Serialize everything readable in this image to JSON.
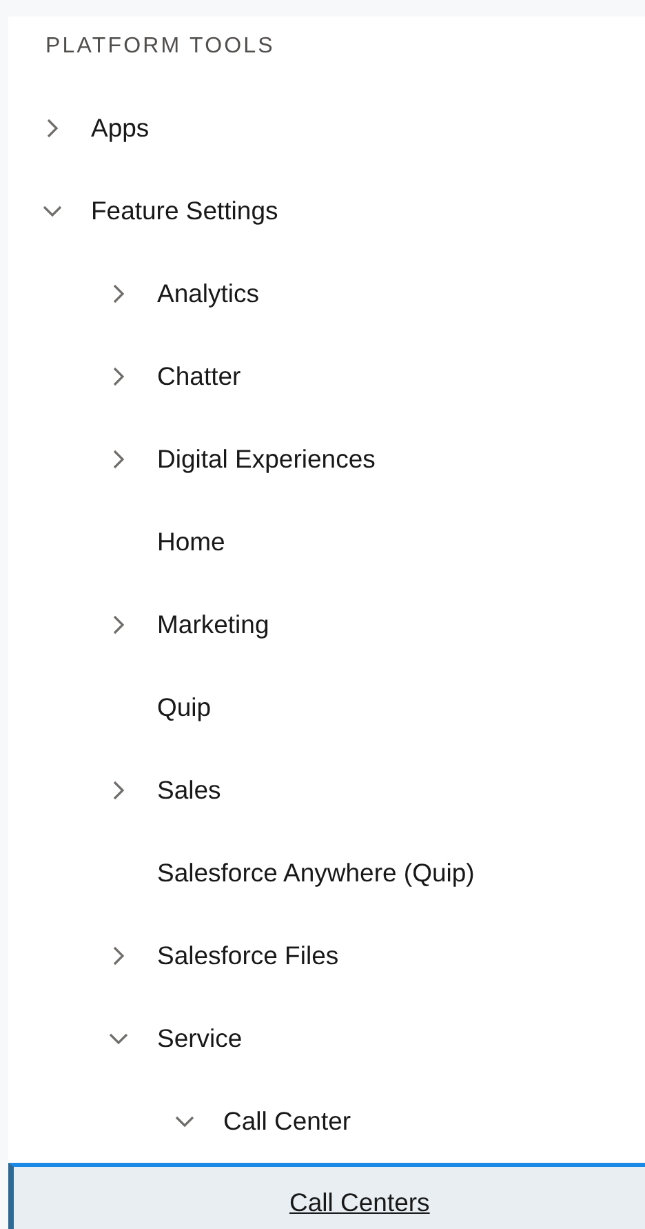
{
  "section_title": "PLATFORM TOOLS",
  "tree": [
    {
      "label": "Apps",
      "expanded": false,
      "selected": false
    },
    {
      "label": "Feature Settings",
      "expanded": true,
      "selected": false,
      "children": [
        {
          "label": "Analytics",
          "expanded": false,
          "selected": false
        },
        {
          "label": "Chatter",
          "expanded": false,
          "selected": false
        },
        {
          "label": "Digital Experiences",
          "expanded": false,
          "selected": false
        },
        {
          "label": "Home",
          "selected": false
        },
        {
          "label": "Marketing",
          "expanded": false,
          "selected": false
        },
        {
          "label": "Quip",
          "selected": false
        },
        {
          "label": "Sales",
          "expanded": false,
          "selected": false
        },
        {
          "label": "Salesforce Anywhere (Quip)",
          "selected": false
        },
        {
          "label": "Salesforce Files",
          "expanded": false,
          "selected": false
        },
        {
          "label": "Service",
          "expanded": true,
          "selected": false,
          "children": [
            {
              "label": "Call Center",
              "expanded": true,
              "selected": false,
              "children": [
                {
                  "label": "Call Centers",
                  "selected": true
                }
              ]
            }
          ]
        }
      ]
    }
  ]
}
